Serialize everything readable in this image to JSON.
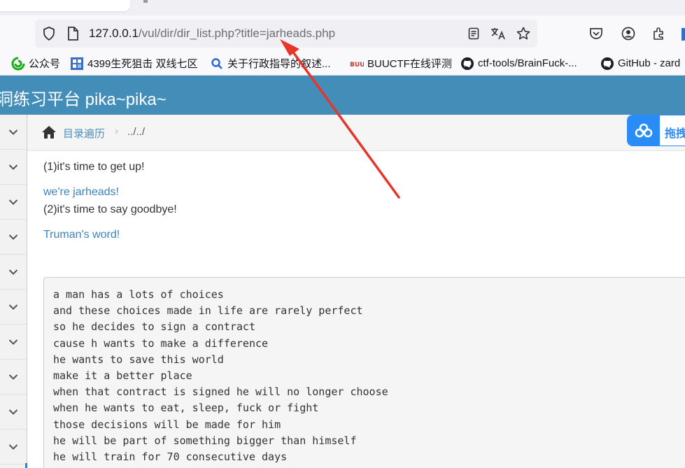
{
  "browser": {
    "url_host": "127.0.0.1",
    "url_path": "/vul/dir/dir_list.php?title=jarheads.php",
    "bookmarks": [
      {
        "label": "公众号",
        "icon": "wechat-icon"
      },
      {
        "label": "4399生死狙击 双线七区",
        "icon": "4399-icon"
      },
      {
        "label": "关于行政指导的叙述...",
        "icon": "search-icon"
      },
      {
        "label": "BUUCTF在线评测",
        "icon": "buuctf-icon"
      },
      {
        "label": "ctf-tools/BrainFuck-...",
        "icon": "github-icon"
      },
      {
        "label": "GitHub - zard",
        "icon": "github-icon"
      }
    ]
  },
  "app": {
    "brand_title": "洞练习平台 pika~pika~",
    "breadcrumb": {
      "link": "目录遍历",
      "separator": "›",
      "current": "../../"
    },
    "float_button_label": "拖拽"
  },
  "content": {
    "line1": "(1)it's time to get up!",
    "link1": "we're jarheads!",
    "line2": "(2)it's time to say goodbye!",
    "link2": "Truman's word!",
    "code_lines": [
      "a man has a lots of choices",
      "and these choices made in life are rarely perfect",
      "so he decides to sign a contract",
      "cause h wants to make a difference",
      "he wants to save this world",
      "make it a better place",
      "when that contract is signed he will no longer choose",
      "when he wants to eat, sleep, fuck or fight",
      "those decisions will be made for him",
      "he will be part of something bigger than himself",
      "he will train for 70 consecutive days"
    ]
  },
  "colors": {
    "header_bg": "#438eb9",
    "link": "#3b83c0",
    "annotation_arrow": "#e8352a"
  }
}
